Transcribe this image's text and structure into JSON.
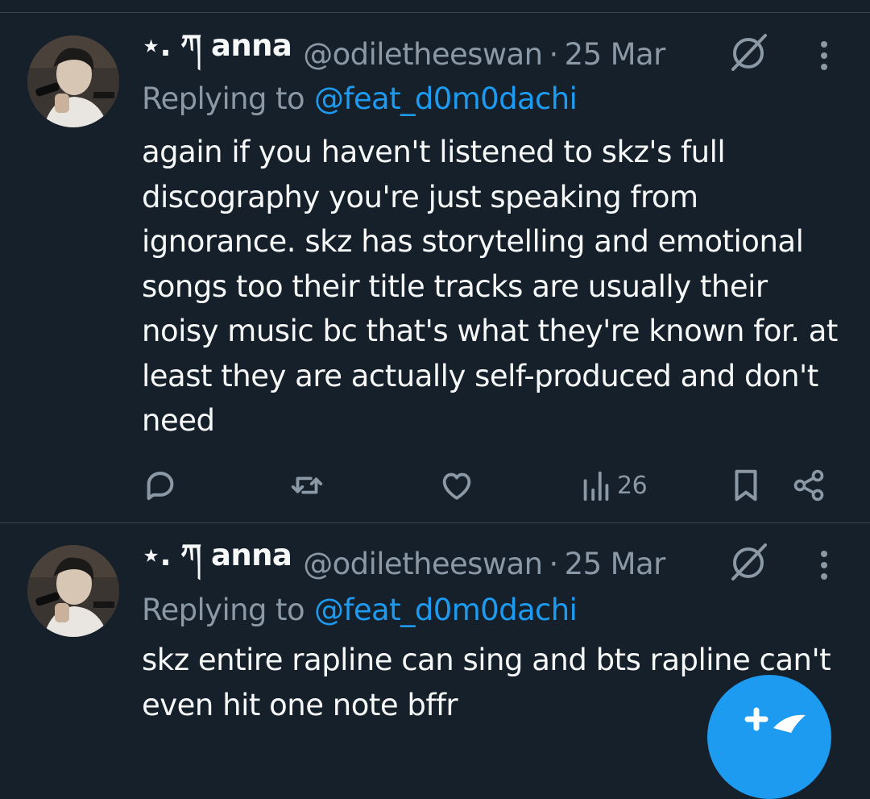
{
  "tweets": [
    {
      "display_name": "⋆. ཀ anna",
      "handle": "@odiletheeswan",
      "separator": "·",
      "date": "25 Mar",
      "replying_prefix": "Replying to",
      "replying_to": "@feat_d0m0dachi",
      "text": "again if you haven't listened to skz's full discography you're just speaking from ignorance. skz has storytelling and emotional songs too their title tracks are usually their noisy music bc that's what they're known for. at least they are actually self-produced and don't need",
      "views": "26"
    },
    {
      "display_name": "⋆. ཀ anna",
      "handle": "@odiletheeswan",
      "separator": "·",
      "date": "25 Mar",
      "replying_prefix": "Replying to",
      "replying_to": "@feat_d0m0dachi",
      "text": "skz entire rapline can sing and bts rapline can't even hit one note bffr"
    }
  ],
  "icons": {
    "reply": "reply-icon",
    "retweet": "retweet-icon",
    "like": "like-icon",
    "views": "views-icon",
    "bookmark": "bookmark-icon",
    "share": "share-icon",
    "grok": "grok-icon",
    "more": "more-icon",
    "compose": "compose-icon"
  },
  "colors": {
    "background": "#15202b",
    "text": "#f7f9f9",
    "muted": "#8b98a5",
    "accent": "#1d9bf0",
    "divider": "#38444d"
  }
}
